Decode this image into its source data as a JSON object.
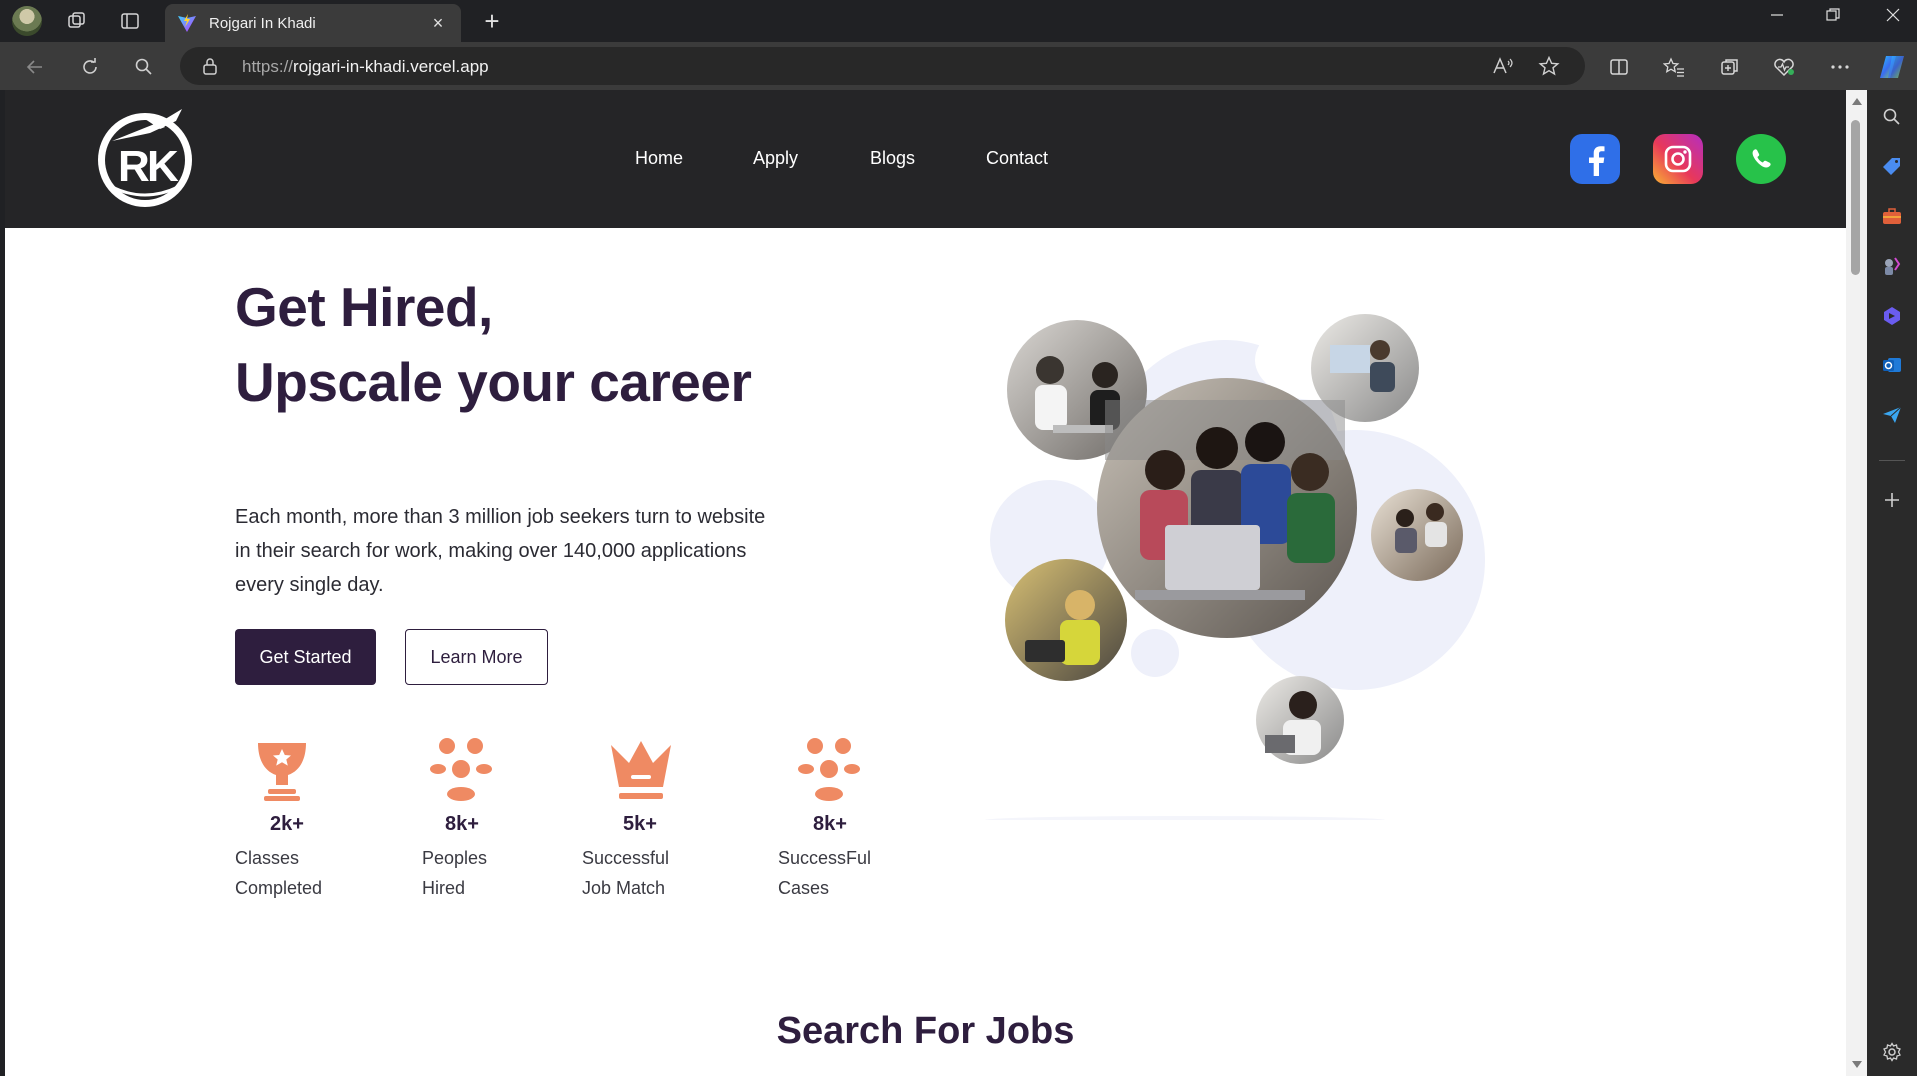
{
  "browser": {
    "tab_title": "Rojgari In Khadi",
    "url_proto": "https://",
    "url_host": "rojgari-in-khadi.vercel.app",
    "new_tab_symbol": "+",
    "close_symbol": "×"
  },
  "site": {
    "nav": [
      "Home",
      "Apply",
      "Blogs",
      "Contact"
    ],
    "social": [
      "facebook-icon",
      "instagram-icon",
      "whatsapp-icon"
    ]
  },
  "hero": {
    "title_line1": "Get Hired,",
    "title_line2": "Upscale your career",
    "description": "Each month, more than 3 million job seekers turn to website in their search for work, making over 140,000 applications every single day.",
    "primary_button": "Get Started",
    "secondary_button": "Learn More"
  },
  "stats": [
    {
      "value": "2k+",
      "label_line1": "Classes",
      "label_line2": "Completed",
      "icon": "trophy-icon"
    },
    {
      "value": "8k+",
      "label_line1": "Peoples",
      "label_line2": "Hired",
      "icon": "people-icon"
    },
    {
      "value": "5k+",
      "label_line1": "Successful",
      "label_line2": "Job Match",
      "icon": "crown-icon"
    },
    {
      "value": "8k+",
      "label_line1": "SuccessFul",
      "label_line2": "Cases",
      "icon": "people-icon"
    }
  ],
  "search_section": {
    "title": "Search For Jobs"
  },
  "colors": {
    "primary": "#2e1e3e",
    "accent": "#ef8a63",
    "header_bg": "#252527",
    "circle_bg": "#eef0fa"
  }
}
